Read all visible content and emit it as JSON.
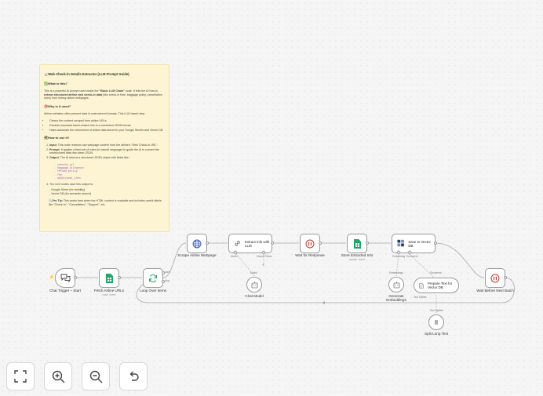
{
  "sticky": {
    "title": "🛫Web Check-in Details Extractor (LLM Prompt Guide)",
    "what_heading": "✅What is this?",
    "what_text_1": "This is a powerful AI prompt used inside the ",
    "what_text_bold_1": "\"Basic LLM Chain\"",
    "what_text_2": " node. It tells the AI how to ",
    "what_text_bold_2": "extract structured airline web check-in data",
    "what_text_3": " (like check-in time, baggage policy, cancellation rules) from messy airline webpages.",
    "why_heading": "🎯Why is it used?",
    "why_text": "Airline websites often present data in unstructured formats. This LLM-based step:",
    "why_items": [
      "Cleans the content scraped from airline URLs.",
      "Extracts important travel-related info in a consistent JSON format.",
      "Helps automate the enrichment of airline data stored in your Google Sheets and Vector DB."
    ],
    "how_heading": "🛠How to use it?",
    "how_items": [
      {
        "bold": "Input",
        "text": ": This node receives raw webpage content from the airline's \"Web Check-in URL\"."
      },
      {
        "bold": "Prompt",
        "text": ": It applies a fixed set of rules (in natural language) to guide the AI to convert the unstructured data into clean JSON."
      },
      {
        "bold": "Output",
        "text": ": The AI returns a structured JSON object with fields like:"
      }
    ],
    "fields": [
      "- checkin_url",
      "- baggage_allowance",
      "- refund_policy",
      "- fee",
      "- additional_info"
    ],
    "how_item_4": "The next nodes save this output to:",
    "destinations": [
      "- Google Sheet (for visibility)",
      "- Vector DB (for semantic search)"
    ],
    "tip_bold": "🔍Pro Tip:",
    "tip_text": " This works best when the HTML content is readable and includes useful labels like \"Check-in\", \"Cancellation\", \"Support\", etc."
  },
  "nodes": {
    "chat_trigger": {
      "label": "Chat Trigger – Start",
      "icon": "chat-bubbles-icon"
    },
    "fetch_urls": {
      "label": "Fetch Airline URLs",
      "sublabel": "read: sheet",
      "icon": "google-sheets-icon"
    },
    "loop": {
      "label": "Loop Over Items",
      "icon": "refresh-icon"
    },
    "scrape": {
      "label": "Scrape Airline Webpage",
      "icon": "globe-icon"
    },
    "extract": {
      "label": "Extract Info with LLM",
      "icon": "link-icon"
    },
    "wait_response": {
      "label": "Wait for Response",
      "icon": "pause-icon"
    },
    "store": {
      "label": "Store Extracted Info",
      "sublabel": "update: sheet",
      "icon": "google-sheets-icon"
    },
    "save_vector": {
      "label": "Save to Vector DB",
      "icon": "vector-db-icon"
    },
    "wait_next": {
      "label": "Wait Before Next Batch",
      "icon": "pause-icon"
    },
    "chat_model": {
      "label": "Chat Model",
      "icon": "robot-icon"
    },
    "embeddings": {
      "label": "Generate Embeddings",
      "icon": "robot-icon"
    },
    "prepare_text": {
      "label": "Prepare Text for Vector DB",
      "icon": "document-icon"
    },
    "split_text": {
      "label": "Split Long Text",
      "icon": "split-icon"
    }
  },
  "port_labels": {
    "loop_done": "done",
    "loop_loop": "loop",
    "model": "Model",
    "output_parser": "Output Parser",
    "model_under": "Model",
    "embedding": "Embedding",
    "document": "Document",
    "embeddings_port": "Embeddings",
    "document_port": "Document",
    "text_splitter": "Text Splitter",
    "text_splitter_port": "Text Splitter"
  },
  "controls": [
    {
      "name": "fit-view-button",
      "icon": "fit-view-icon"
    },
    {
      "name": "zoom-in-button",
      "icon": "zoom-in-icon"
    },
    {
      "name": "zoom-out-button",
      "icon": "zoom-out-icon"
    },
    {
      "name": "reset-zoom-button",
      "icon": "undo-icon"
    }
  ],
  "colors": {
    "sticky_bg": "#fdf4d3",
    "sheets_green": "#23a566",
    "wait_red": "#c0392b",
    "trigger_plus": "#e0655f",
    "code_purple": "#9b59b6"
  }
}
